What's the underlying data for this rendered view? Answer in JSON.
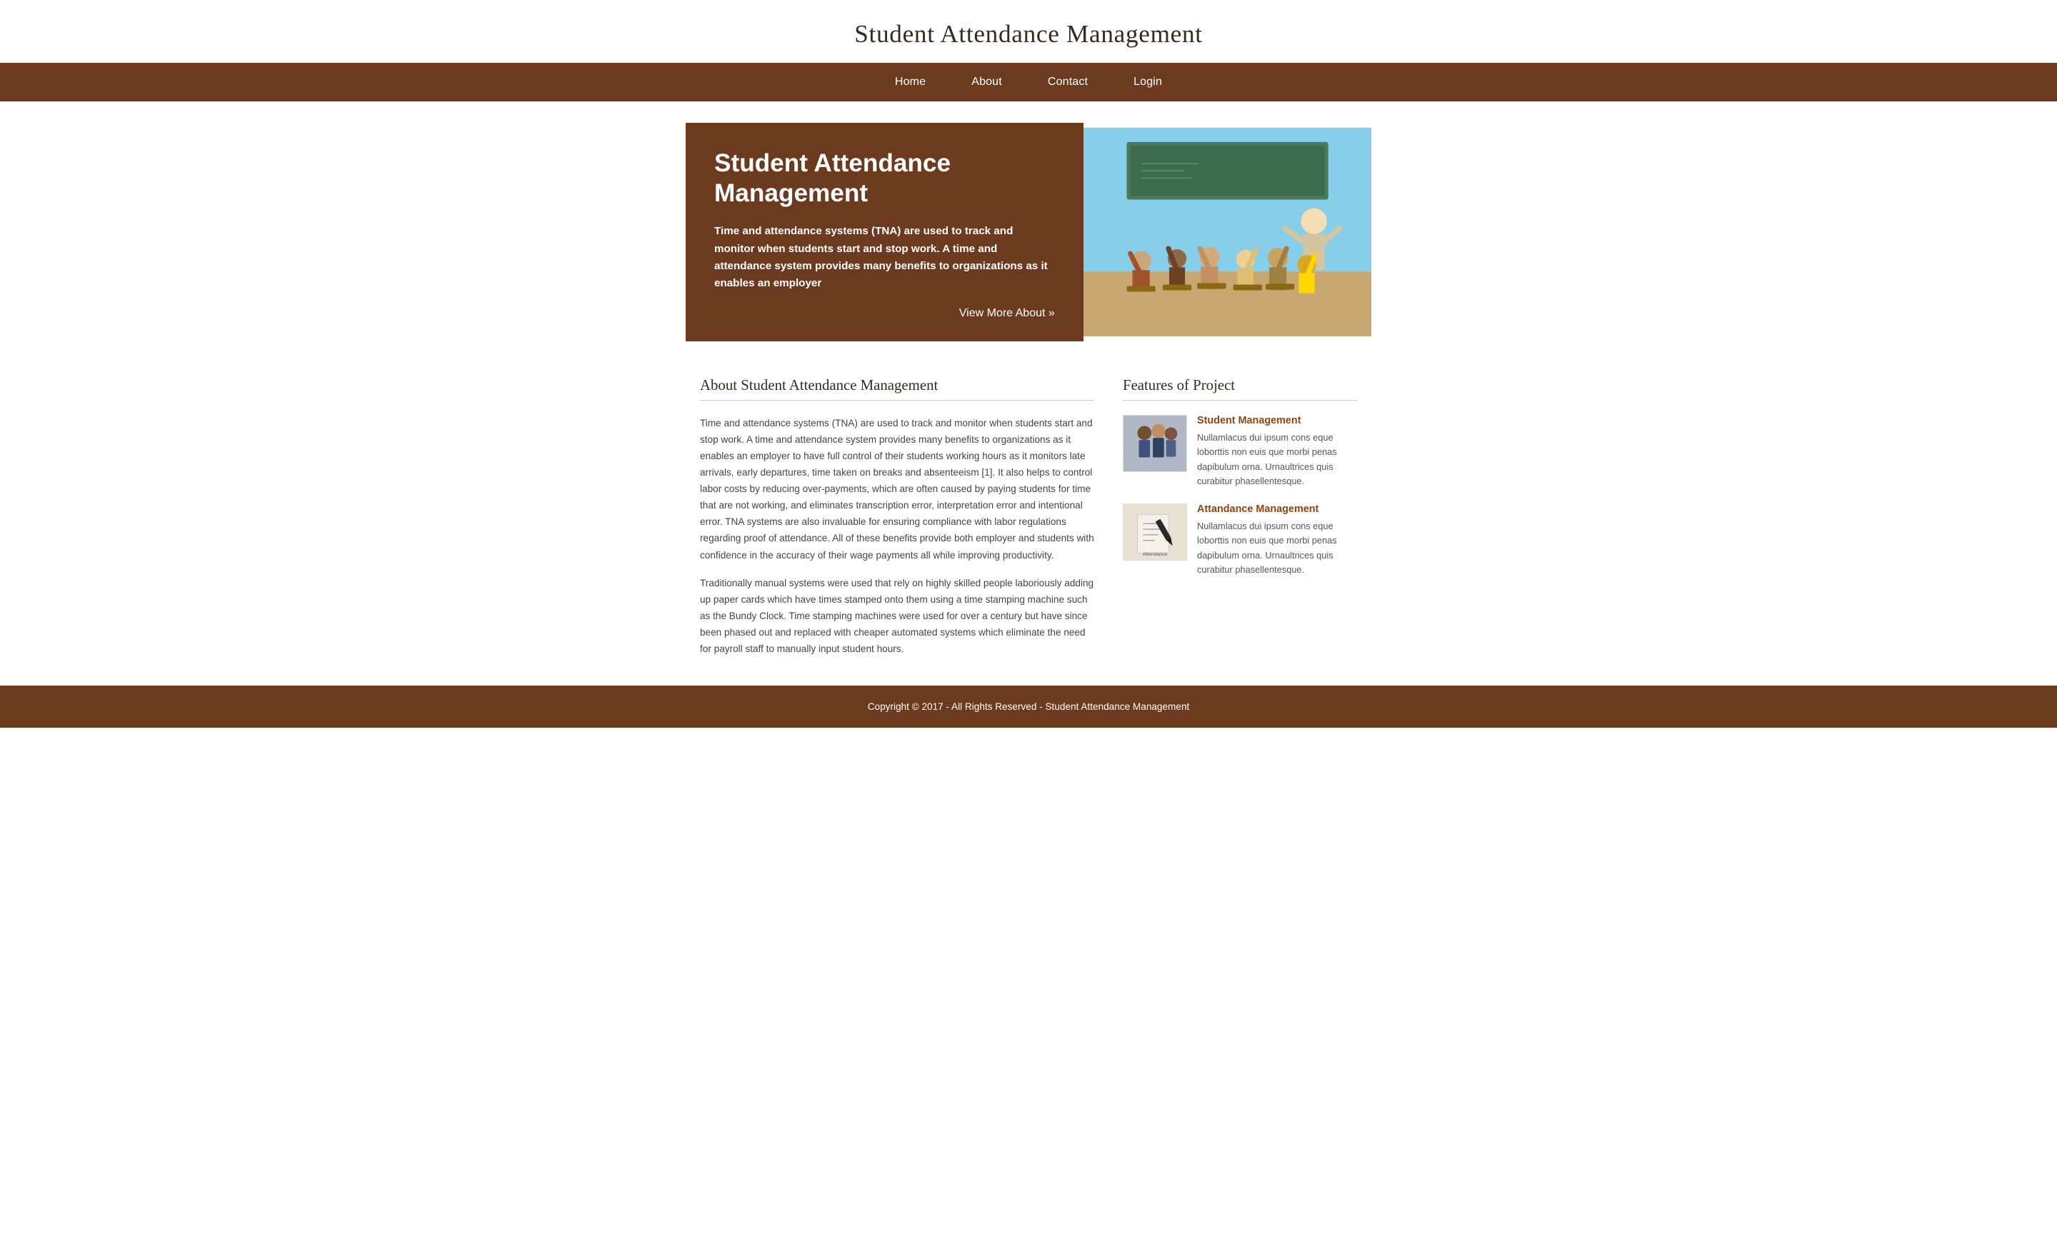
{
  "site": {
    "title": "Student Attendance Management"
  },
  "nav": {
    "items": [
      {
        "label": "Home",
        "href": "#"
      },
      {
        "label": "About",
        "href": "#"
      },
      {
        "label": "Contact",
        "href": "#"
      },
      {
        "label": "Login",
        "href": "#"
      }
    ]
  },
  "hero": {
    "title": "Student Attendance Management",
    "description": "Time and attendance systems (TNA) are used to track and monitor when students start and stop work. A time and attendance system provides many benefits to organizations as it enables an employer",
    "link_text": "View More About »"
  },
  "about": {
    "section_title": "About Student Attendance Management",
    "paragraph1": "Time and attendance systems (TNA) are used to track and monitor when students start and stop work. A time and attendance system provides many benefits to organizations as it enables an employer to have full control of their students working hours as it monitors late arrivals, early departures, time taken on breaks and absenteeism [1]. It also helps to control labor costs by reducing over-payments, which are often caused by paying students for time that are not working, and eliminates transcription error, interpretation error and intentional error. TNA systems are also invaluable for ensuring compliance with labor regulations regarding proof of attendance. All of these benefits provide both employer and students with confidence in the accuracy of their wage payments all while improving productivity.",
    "paragraph2": "Traditionally manual systems were used that rely on highly skilled people laboriously adding up paper cards which have times stamped onto them using a time stamping machine such as the Bundy Clock. Time stamping machines were used for over a century but have since been phased out and replaced with cheaper automated systems which eliminate the need for payroll staff to manually input student hours."
  },
  "features": {
    "section_title": "Features of Project",
    "items": [
      {
        "name": "Student Management",
        "image_label": "",
        "description": "Nullamlacus dui ipsum cons eque loborttis non euis que morbi penas dapibulum orna. Urnaultrices quis curabitur phasellentesque."
      },
      {
        "name": "Attandance Management",
        "image_label": "Attendance",
        "description": "Nullamlacus dui ipsum cons eque loborttis non euis que morbi penas dapibulum orna. Urnaultrices quis curabitur phasellentesque."
      }
    ]
  },
  "footer": {
    "text": "Copyright © 2017 - All Rights Reserved - Student Attendance Management"
  }
}
